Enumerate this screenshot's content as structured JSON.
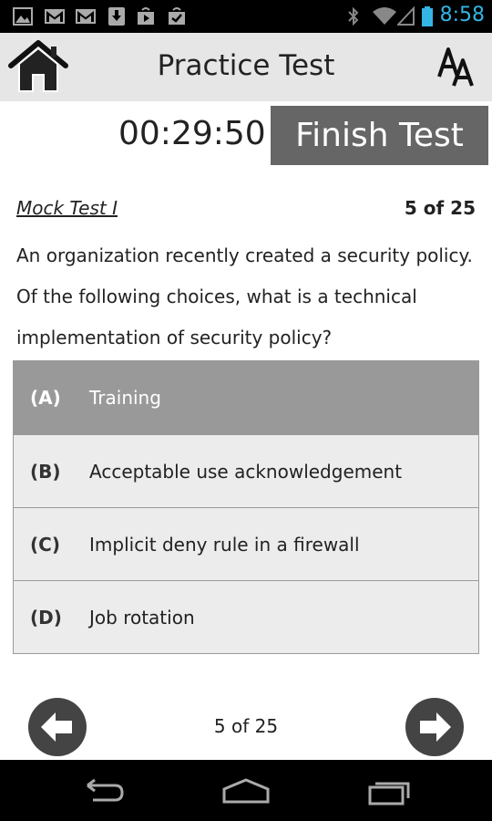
{
  "status_bar": {
    "time": "8:58",
    "icons": [
      "image-icon",
      "gmail-icon",
      "gmail-icon",
      "download-icon",
      "play-store-icon",
      "task-check-icon",
      "bluetooth-icon",
      "wifi-icon",
      "signal-icon",
      "battery-icon"
    ]
  },
  "app_bar": {
    "title": "Practice Test",
    "home_icon": "home-icon",
    "font_icon": "font-size-icon"
  },
  "timer": {
    "value": "00:29:50",
    "finish_label": "Finish Test"
  },
  "question": {
    "test_name": "Mock Test I",
    "counter": "5 of 25",
    "text": "An organization recently created a security policy. Of the following choices, what is a technical implementation of security policy?",
    "options": [
      {
        "letter": "(A)",
        "text": "Training",
        "selected": true
      },
      {
        "letter": "(B)",
        "text": "Acceptable use acknowledgement",
        "selected": false
      },
      {
        "letter": "(C)",
        "text": "Implicit deny rule in a firewall",
        "selected": false
      },
      {
        "letter": "(D)",
        "text": "Job rotation",
        "selected": false
      }
    ]
  },
  "footer": {
    "counter": "5 of 25",
    "prev_icon": "arrow-left-icon",
    "next_icon": "arrow-right-icon"
  },
  "colors": {
    "accent_time": "#33b5e5",
    "app_bar_bg": "#e6e6e6",
    "finish_bg": "#666666",
    "selected_option_bg": "#999999",
    "option_bg": "#ececec",
    "nav_button_bg": "#444444"
  }
}
